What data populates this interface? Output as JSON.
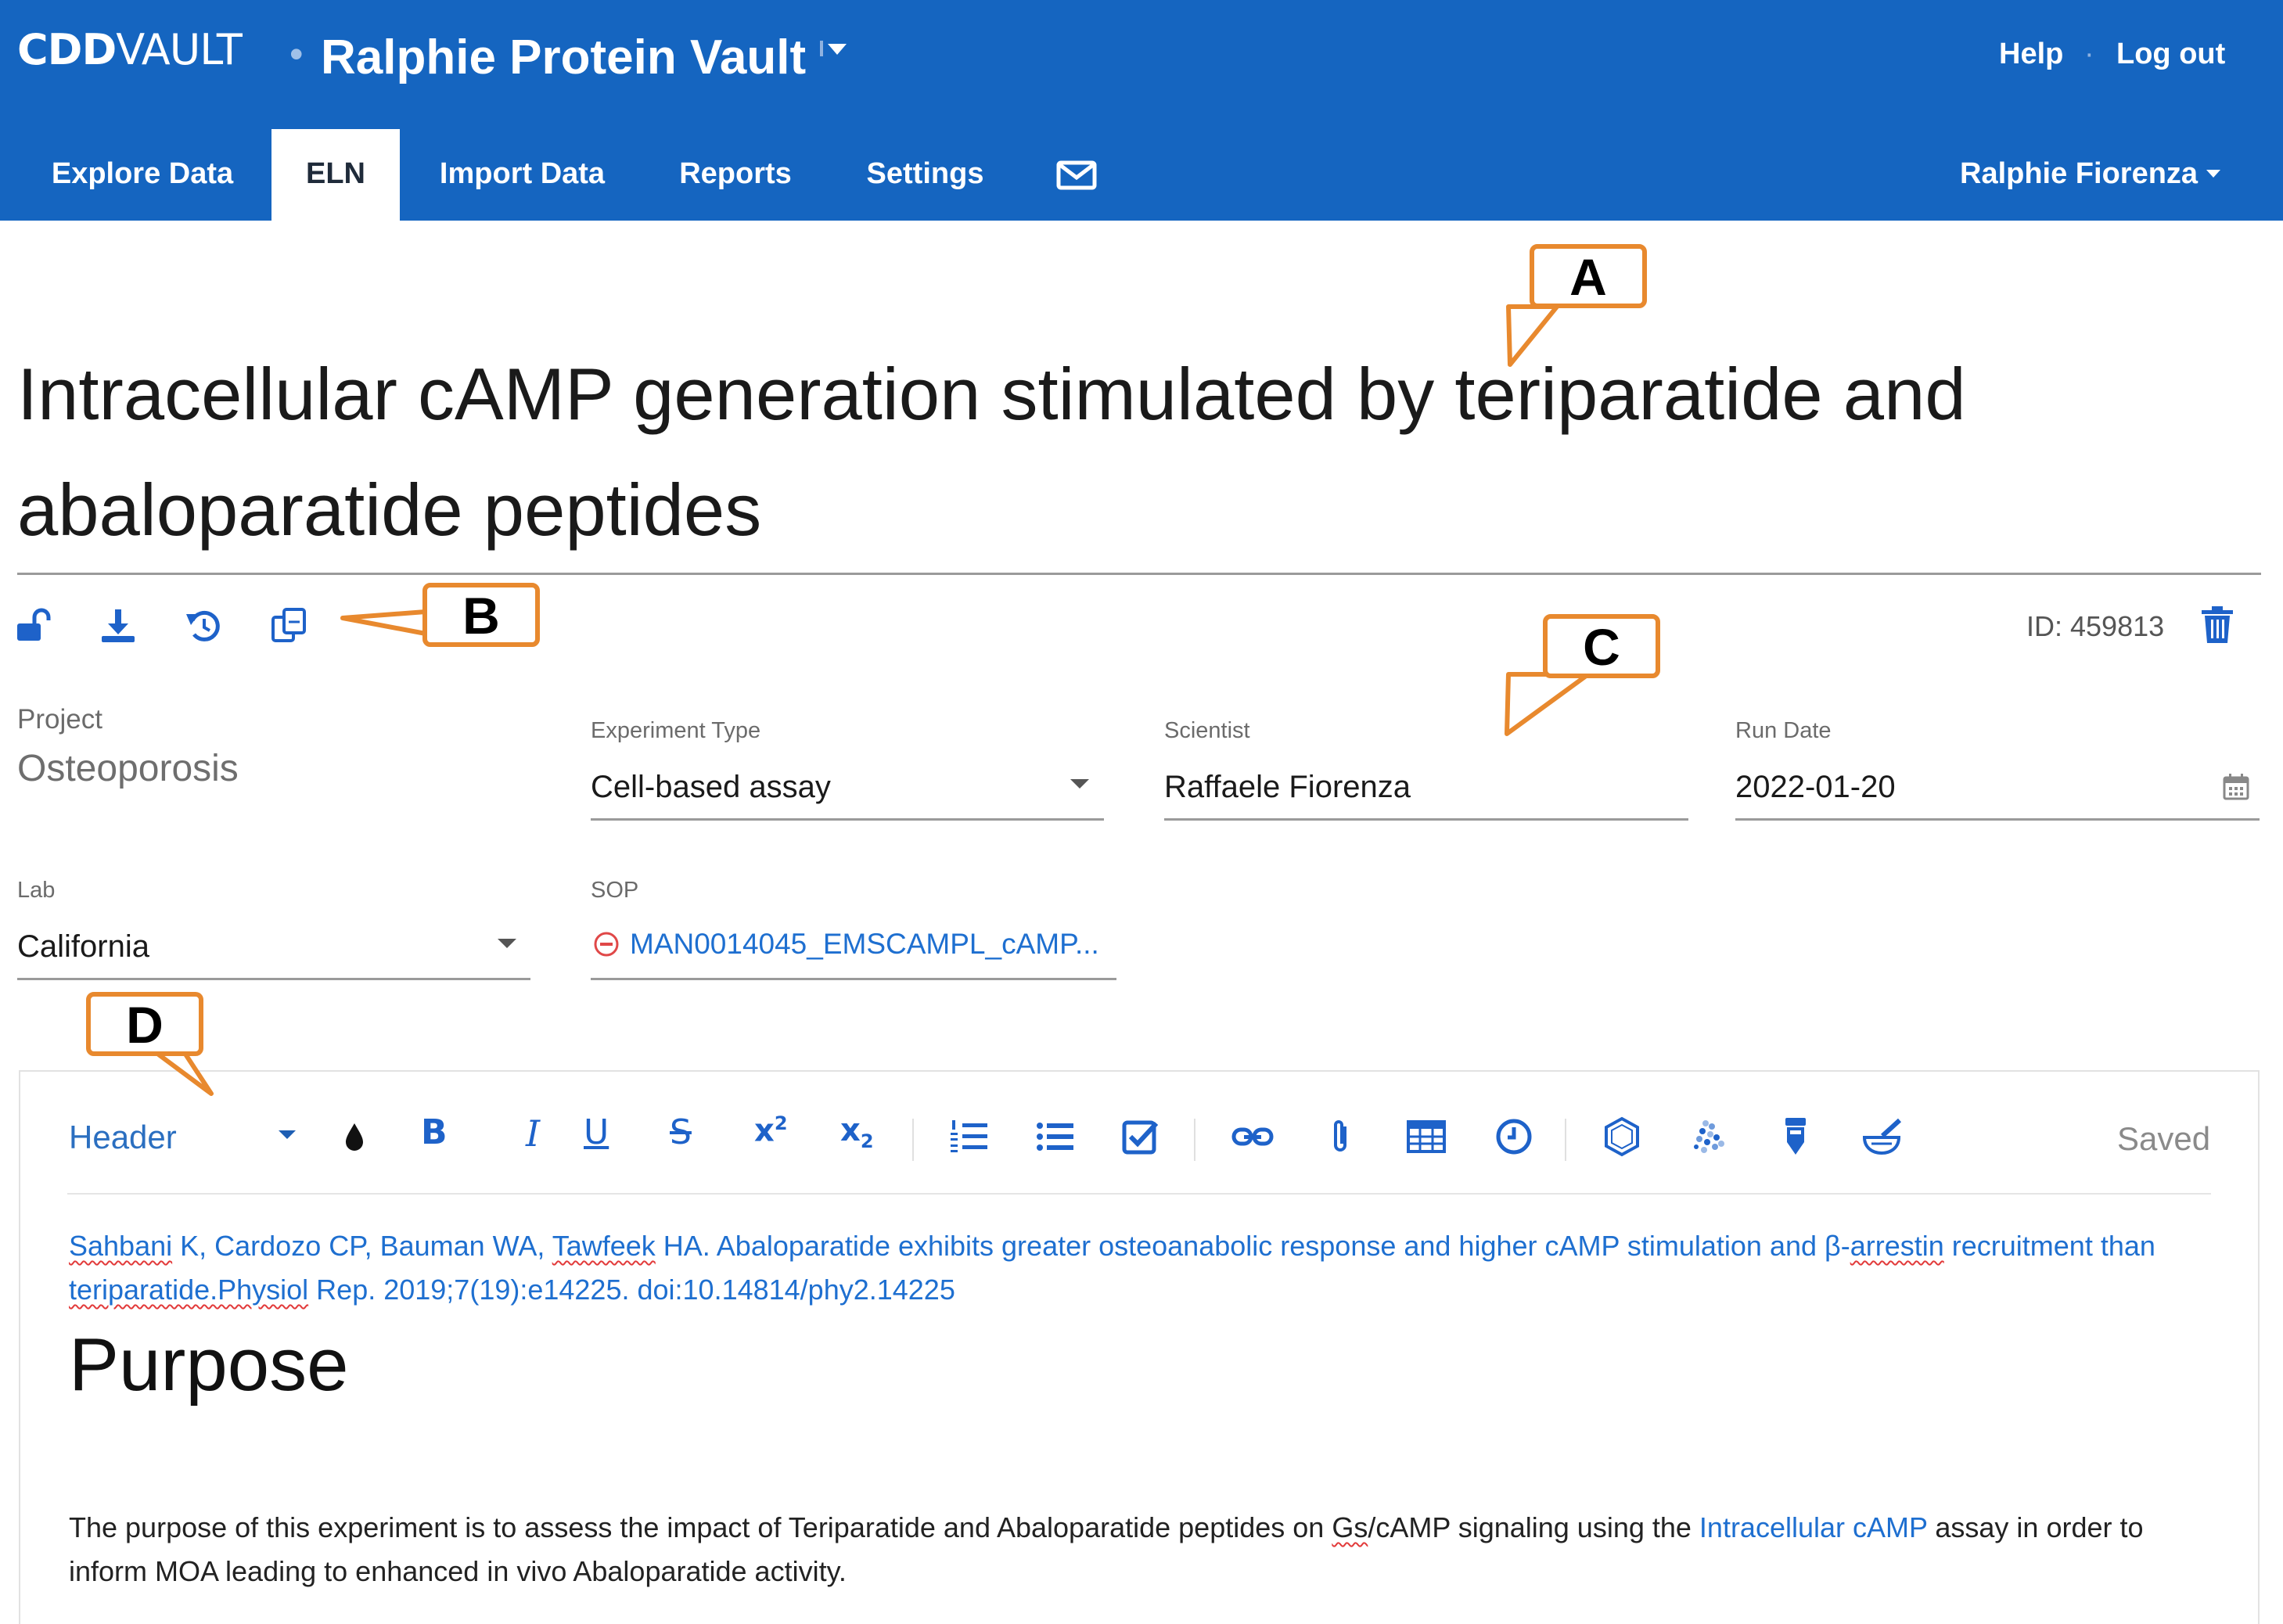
{
  "header": {
    "logo_primary": "CDD",
    "logo_secondary": "VAULT",
    "logo_separator": "•",
    "vault_name": "Ralphie Protein Vault",
    "help": "Help",
    "separator": "·",
    "logout": "Log out"
  },
  "nav": {
    "tabs": [
      {
        "label": "Explore Data",
        "active": false
      },
      {
        "label": "ELN",
        "active": true
      },
      {
        "label": "Import Data",
        "active": false
      },
      {
        "label": "Reports",
        "active": false
      },
      {
        "label": "Settings",
        "active": false
      }
    ],
    "mail_icon": "mail-icon",
    "user": "Ralphie Fiorenza"
  },
  "entry": {
    "title_line1": "Intracellular cAMP generation stimulated by teriparatide and",
    "title_line2": "abaloparatide peptides",
    "id_label": "ID: 459813",
    "actions": [
      "unlock-icon",
      "download-icon",
      "history-icon",
      "copy-icon"
    ],
    "delete_icon": "trash-icon"
  },
  "fields": {
    "project": {
      "label": "Project",
      "value": "Osteoporosis"
    },
    "experiment_type": {
      "label": "Experiment Type",
      "value": "Cell-based assay"
    },
    "scientist": {
      "label": "Scientist",
      "value": "Raffaele Fiorenza"
    },
    "run_date": {
      "label": "Run Date",
      "value": "2022-01-20"
    },
    "lab": {
      "label": "Lab",
      "value": "California"
    },
    "sop": {
      "label": "SOP",
      "value": "MAN0014045_EMSCAMPL_cAMP..."
    }
  },
  "editor": {
    "style_select": "Header",
    "status": "Saved",
    "toolbar": {
      "bold": "B",
      "italic": "I",
      "underline": "U",
      "strike": "S",
      "sup_base": "x",
      "sup": "2",
      "sub_base": "x",
      "sub": "2"
    },
    "citation": {
      "a1": "Sahbani",
      "t1": " K, Cardozo CP, Bauman WA, ",
      "a2": "Tawfeek",
      "t2": " HA. Abaloparatide exhibits greater osteoanabolic response and higher cAMP stimulation and β-",
      "a3": "arrestin",
      "t3": " recruitment than ",
      "a4": "teriparatide.Physiol",
      "t4": " Rep. 2019;7(19):e14225. doi:10.14814/phy2.14225"
    },
    "heading": "Purpose",
    "body": {
      "p1": "The purpose of this experiment is to assess the impact of Teriparatide and Abaloparatide peptides on ",
      "gs": "Gs",
      "p2": "/cAMP signaling using the ",
      "link": "Intracellular cAMP",
      "p3": " assay in order to inform MOA leading to enhanced in vivo Abaloparatide activity."
    }
  },
  "annotations": {
    "a": "A",
    "b": "B",
    "c": "C",
    "d": "D",
    "color": "#e8892e"
  },
  "colors": {
    "brand": "#1565c0",
    "link": "#1e6fd0",
    "icon": "#1e62c9"
  }
}
